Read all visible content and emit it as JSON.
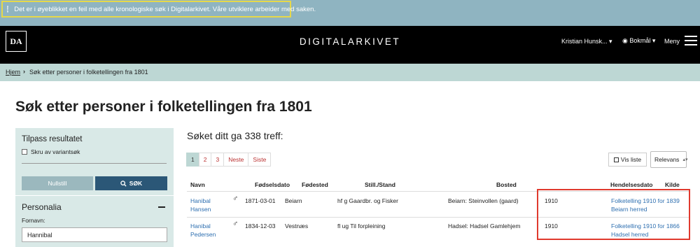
{
  "alert": {
    "text": "Det er i øyeblikket en feil med alle kronologiske søk i Digitalarkivet. Våre utviklere arbeider med saken."
  },
  "header": {
    "logo": "DA",
    "title": "DIGITALARKIVET",
    "user": "Kristian Hunsk... ▾",
    "language": "Bokmål ▾",
    "menu": "Meny"
  },
  "breadcrumb": {
    "home": "Hjem",
    "separator": "›",
    "current": "Søk etter personer i folketellingen fra 1801"
  },
  "page": {
    "title": "Søk etter personer i folketellingen fra 1801"
  },
  "sidebar": {
    "title": "Tilpass resultatet",
    "variant_label": "Skru av variantsøk",
    "reset_label": "Nullstill",
    "search_label": "SØK",
    "section": "Personalia",
    "firstname_label": "Fornavn:",
    "firstname_value": "Hannibal"
  },
  "results": {
    "count_text": "Søket ditt ga 338 treff:",
    "pages": [
      "1",
      "2",
      "3",
      "Neste",
      "Siste"
    ],
    "view_label": "Vis liste",
    "sort_label": "Relevans",
    "columns": [
      "Navn",
      "Fødselsdato",
      "Fødested",
      "Still./Stand",
      "Bosted",
      "Hendelsesdato",
      "Kilde"
    ],
    "rows": [
      {
        "name1": "Hanibal",
        "name2": "Hansen",
        "gender": "♂",
        "birthdate": "1871-03-01",
        "birthplace": "Beiarn",
        "position": "hf g Gaardbr. og Fisker",
        "residence": "Beiarn: Steinvollen (gaard)",
        "event_date": "1910",
        "source1": "Folketelling 1910 for 1839",
        "source2": "Beiarn herred"
      },
      {
        "name1": "Hanibal",
        "name2": "Pedersen",
        "gender": "♂",
        "birthdate": "1834-12-03",
        "birthplace": "Vestnæs",
        "position": "fl ug Til forpleining",
        "residence": "Hadsel: Hadsel Gamlehjem",
        "event_date": "1910",
        "source1": "Folketelling 1910 for 1866",
        "source2": "Hadsel herred"
      }
    ]
  },
  "colors": {
    "alert_bg": "#8fb4c1",
    "alert_border": "#e6d84a",
    "breadcrumb_bg": "#bdd7d4",
    "sidebar_bg": "#d9e9e7",
    "search_btn": "#2b5777",
    "link": "#2e6fb0",
    "highlight": "#e03a2e"
  },
  "icons": {
    "info": "info-icon",
    "globe": "globe-icon",
    "menu": "hamburger-icon",
    "search": "search-icon",
    "list": "list-icon",
    "gender": "male-icon"
  }
}
